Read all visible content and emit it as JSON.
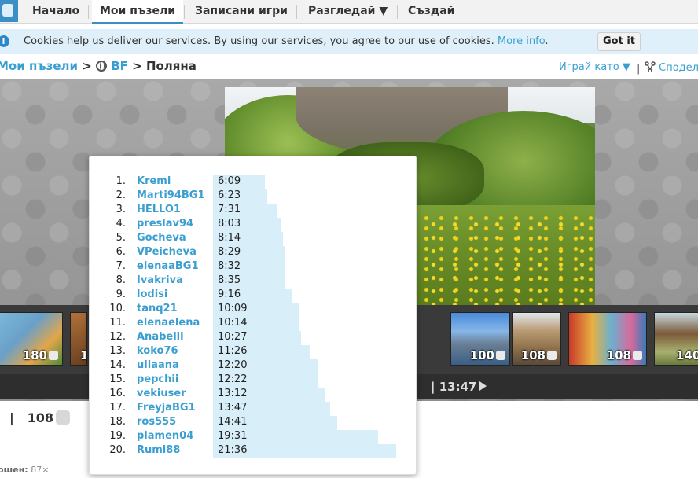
{
  "nav": {
    "items": [
      "Начало",
      "Мои пъзели",
      "Записани игри",
      "Разгледай ▼",
      "Създай"
    ],
    "active_index": 1
  },
  "cookie": {
    "icon": "info-icon",
    "text": "Cookies help us deliver our services. By using our services, you agree to our use of cookies. ",
    "more_link": "More info",
    "period": ".",
    "button": "Got it"
  },
  "breadcrumb": {
    "part1": "Мои пъзели",
    "sep1": " > ",
    "part2": "BF",
    "sep2": " > ",
    "current": "Поляна",
    "play_as": "Играй като ▼",
    "divider": "|",
    "share": "Сподел"
  },
  "thumbnails": [
    {
      "count": "180"
    },
    {
      "count": "1"
    },
    {
      "count": "100"
    },
    {
      "count": "108"
    },
    {
      "count": "108"
    },
    {
      "count": "140"
    }
  ],
  "timebar": {
    "text": "| 13:47"
  },
  "stats": {
    "divider": "|",
    "pieces": "108",
    "solved_label": "ошен:",
    "solved_value": "87×"
  },
  "close_symbol": "✖",
  "leaderboard": [
    {
      "rank": "1.",
      "name": "Kremi",
      "time": "6:09",
      "seconds": 369
    },
    {
      "rank": "2.",
      "name": "Marti94BG1",
      "time": "6:23",
      "seconds": 383
    },
    {
      "rank": "3.",
      "name": "HELLO1",
      "time": "7:31",
      "seconds": 451
    },
    {
      "rank": "4.",
      "name": "preslav94",
      "time": "8:03",
      "seconds": 483
    },
    {
      "rank": "5.",
      "name": "Gocheva",
      "time": "8:14",
      "seconds": 494
    },
    {
      "rank": "6.",
      "name": "VPeicheva",
      "time": "8:29",
      "seconds": 509
    },
    {
      "rank": "7.",
      "name": "elenaaBG1",
      "time": "8:32",
      "seconds": 512
    },
    {
      "rank": "8.",
      "name": "Ivakriva",
      "time": "8:35",
      "seconds": 515
    },
    {
      "rank": "9.",
      "name": "lodisi",
      "time": "9:16",
      "seconds": 556
    },
    {
      "rank": "10.",
      "name": "tanq21",
      "time": "10:09",
      "seconds": 609
    },
    {
      "rank": "11.",
      "name": "elenaelena",
      "time": "10:14",
      "seconds": 614
    },
    {
      "rank": "12.",
      "name": "Anabelll",
      "time": "10:27",
      "seconds": 627
    },
    {
      "rank": "13.",
      "name": "koko76",
      "time": "11:26",
      "seconds": 686
    },
    {
      "rank": "14.",
      "name": "uliaana",
      "time": "12:20",
      "seconds": 740
    },
    {
      "rank": "15.",
      "name": "pepchii",
      "time": "12:22",
      "seconds": 742
    },
    {
      "rank": "16.",
      "name": "vekiuser",
      "time": "13:12",
      "seconds": 792
    },
    {
      "rank": "17.",
      "name": "FreyjaBG1",
      "time": "13:47",
      "seconds": 827
    },
    {
      "rank": "18.",
      "name": "ros555",
      "time": "14:41",
      "seconds": 881
    },
    {
      "rank": "19.",
      "name": "plamen04",
      "time": "19:31",
      "seconds": 1171
    },
    {
      "rank": "20.",
      "name": "Rumi88",
      "time": "21:36",
      "seconds": 1296
    }
  ]
}
